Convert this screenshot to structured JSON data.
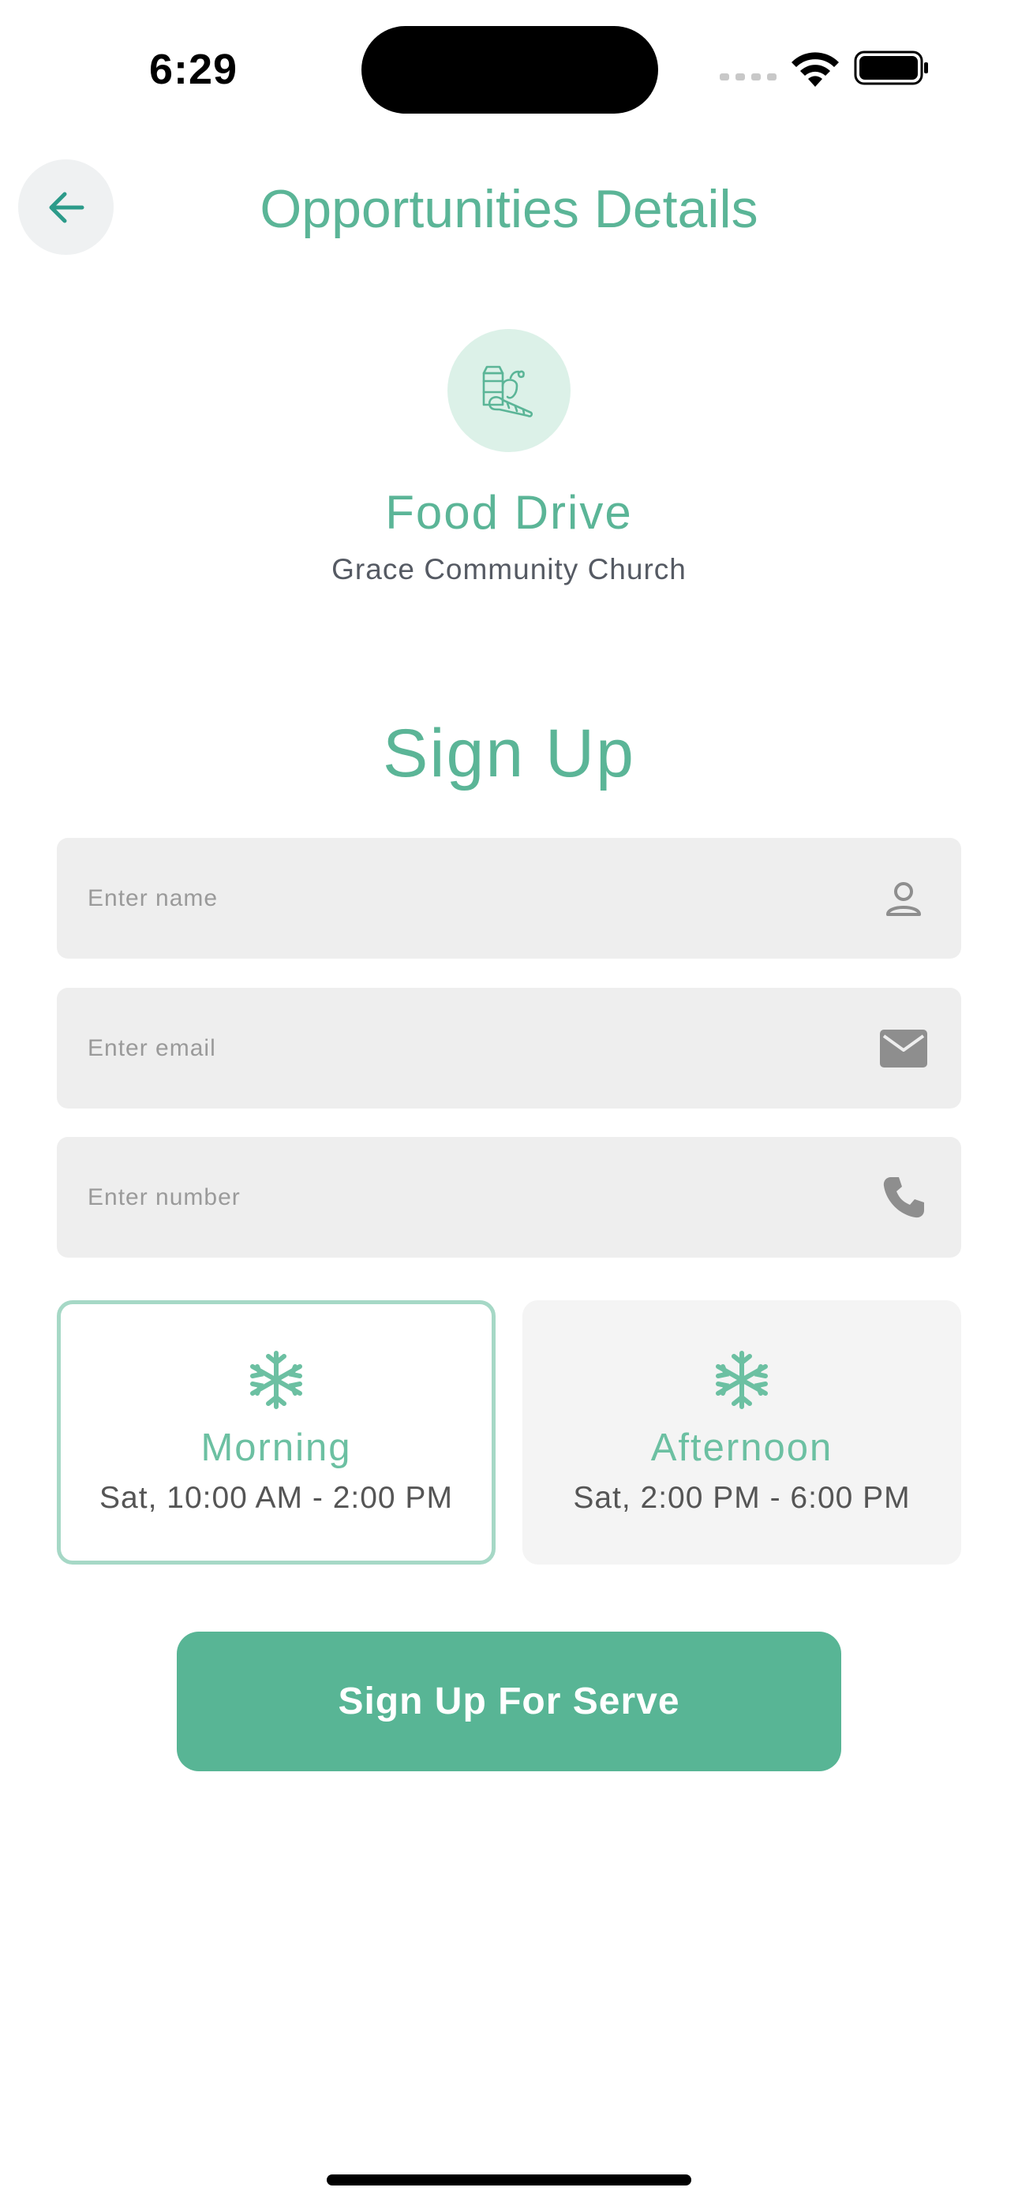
{
  "status_bar": {
    "time": "6:29"
  },
  "header": {
    "title": "Opportunities Details",
    "back_icon": "arrow-left-icon"
  },
  "opportunity": {
    "icon": "grocery-bag-icon",
    "name": "Food Drive",
    "organization": "Grace Community Church"
  },
  "signup": {
    "heading": "Sign Up",
    "fields": {
      "name": {
        "placeholder": "Enter name",
        "value": "",
        "icon": "person-icon"
      },
      "email": {
        "placeholder": "Enter email",
        "value": "",
        "icon": "mail-icon"
      },
      "number": {
        "placeholder": "Enter number",
        "value": "",
        "icon": "phone-icon"
      }
    },
    "shifts": [
      {
        "label": "Morning",
        "time": "Sat, 10:00 AM - 2:00 PM",
        "selected": true,
        "icon": "snowflake-icon"
      },
      {
        "label": "Afternoon",
        "time": "Sat, 2:00 PM - 6:00 PM",
        "selected": false,
        "icon": "snowflake-icon"
      }
    ],
    "submit_label": "Sign Up For Serve"
  },
  "colors": {
    "accent": "#5bb597",
    "button": "#58b595",
    "selected_border": "#a6d8c6",
    "field_bg": "#eeeeee"
  }
}
